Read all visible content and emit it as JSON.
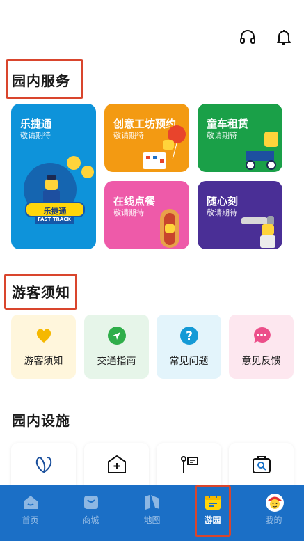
{
  "header": {
    "icons": [
      "headphones-icon",
      "bell-icon"
    ]
  },
  "park_services": {
    "title": "园内服务",
    "cards": [
      {
        "title": "乐捷通",
        "subtitle": "敬请期待",
        "badge": "乐捷通",
        "badge_sub": "FAST TRACK",
        "color": "#0e93da"
      },
      {
        "title": "创意工坊预约",
        "subtitle": "敬请期待",
        "color": "#f39a12"
      },
      {
        "title": "童车租赁",
        "subtitle": "敬请期待",
        "color": "#1aa048"
      },
      {
        "title": "在线点餐",
        "subtitle": "敬请期待",
        "color": "#ee5aa9"
      },
      {
        "title": "随心刻",
        "subtitle": "敬请期待",
        "color": "#4a2f96"
      }
    ]
  },
  "visitor_notice": {
    "title": "游客须知",
    "items": [
      {
        "label": "游客须知",
        "icon": "heart-icon",
        "bg": "#fff6dc",
        "color": "#f5b800"
      },
      {
        "label": "交通指南",
        "icon": "navigation-icon",
        "bg": "#e6f5e9",
        "color": "#2fae4a"
      },
      {
        "label": "常见问题",
        "icon": "question-icon",
        "bg": "#e3f4fb",
        "color": "#159ad6"
      },
      {
        "label": "意见反馈",
        "icon": "chat-icon",
        "bg": "#fde7ef",
        "color": "#ec4f8a"
      }
    ]
  },
  "facilities": {
    "title": "园内设施",
    "items": [
      "ribbon-icon",
      "first-aid-icon",
      "info-kiosk-icon",
      "locker-search-icon"
    ]
  },
  "tabbar": {
    "items": [
      {
        "label": "首页",
        "icon": "home-icon",
        "active": false
      },
      {
        "label": "商城",
        "icon": "shopping-bag-icon",
        "active": false
      },
      {
        "label": "地图",
        "icon": "map-icon",
        "active": false
      },
      {
        "label": "游园",
        "icon": "calendar-icon",
        "active": true
      },
      {
        "label": "我的",
        "icon": "avatar-icon",
        "active": false
      }
    ]
  }
}
